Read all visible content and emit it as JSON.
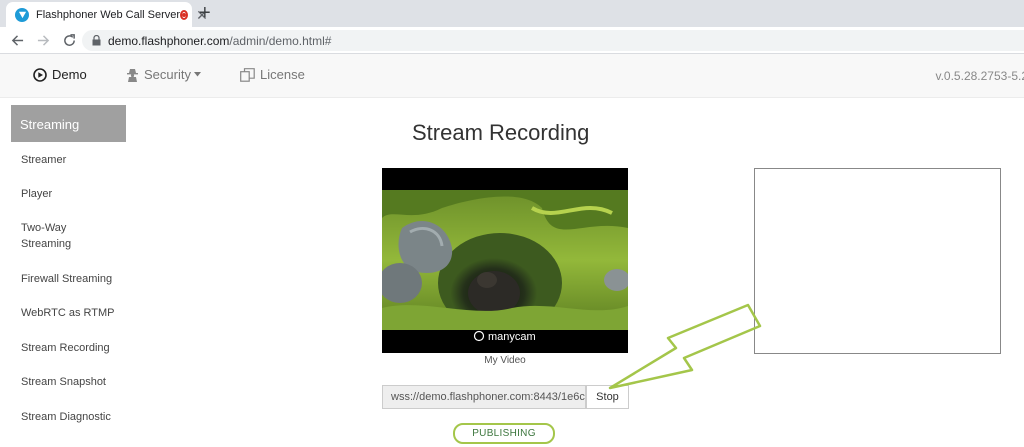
{
  "browser": {
    "tab_title": "Flashphoner Web Call Server",
    "url_host": "demo.flashphoner.com",
    "url_path": "/admin/demo.html#"
  },
  "nav": {
    "items": [
      {
        "label": "Demo",
        "icon": "play-circle-icon"
      },
      {
        "label": "Security",
        "icon": "user-secret-icon"
      },
      {
        "label": "License",
        "icon": "copy-icon"
      }
    ],
    "version": "v.0.5.28.2753-5.2"
  },
  "sidebar": {
    "header": "Streaming",
    "items": [
      "Streamer",
      "Player",
      "Two-Way Streaming",
      "Firewall Streaming",
      "WebRTC as RTMP",
      "Stream Recording",
      "Stream Snapshot",
      "Stream Diagnostic"
    ]
  },
  "main": {
    "title": "Stream Recording",
    "video_label": "My Video",
    "watermark": "manycam",
    "url_value": "wss://demo.flashphoner.com:8443/1e6c",
    "stop_label": "Stop",
    "status": "PUBLISHING"
  },
  "colors": {
    "sidebar_active": "#a0a0a0",
    "status_border": "#a4c64a",
    "arrow": "#a4c64a"
  }
}
